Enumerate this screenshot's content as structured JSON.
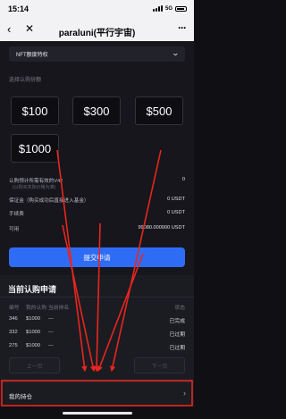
{
  "status_bar": {
    "time": "15:14",
    "network": "5G"
  },
  "nav": {
    "title": "paraluni(平行宇宙)",
    "back_icon": "chevron-left-icon",
    "close_icon": "close-icon",
    "more_icon": "more-icon"
  },
  "form": {
    "product_select": "NFT额度特权",
    "amount_label": "选择认购份额",
    "amounts": [
      "$100",
      "$300",
      "$500",
      "$1000"
    ],
    "rows": [
      {
        "label": "认购预计所需有效的V42",
        "value": "0"
      },
      {
        "label": "保证金（购买成功后直接进入基金）",
        "value": "0 USDT"
      },
      {
        "label": "手续费",
        "value": "0 USDT"
      },
      {
        "label": "可用",
        "value": "99080.000000 USDT"
      }
    ],
    "sub_note": "(以购买实际价格为准)",
    "submit_label": "提交申请"
  },
  "records": {
    "title": "当前认购申请",
    "columns": [
      "编号",
      "我的认购",
      "当前排名",
      "状态"
    ],
    "items": [
      {
        "id": "346",
        "amount": "$1000",
        "rank": "---",
        "status": "已完成"
      },
      {
        "id": "332",
        "amount": "$1000",
        "rank": "---",
        "status": "已过期"
      },
      {
        "id": "275",
        "amount": "$1000",
        "rank": "---",
        "status": "已过期"
      }
    ],
    "prev_label": "上一页",
    "next_label": "下一页"
  },
  "holdings": {
    "label": "我的持仓"
  },
  "colors": {
    "accent": "#2f6cf6",
    "annotation": "#e8261e",
    "background": "#0f0f14"
  }
}
